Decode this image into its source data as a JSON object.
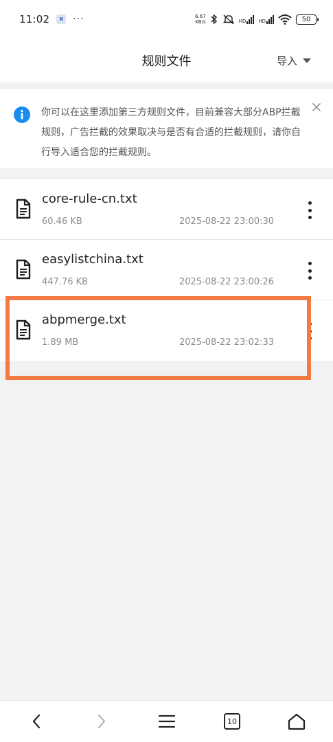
{
  "status_bar": {
    "time": "11:02",
    "app_badge": "x",
    "more_dots": "···",
    "net_speed_value": "6.67",
    "net_speed_unit": "KB/s",
    "signal1_label": "HD",
    "signal2_label": "HD",
    "battery": "50"
  },
  "header": {
    "title": "规则文件",
    "import_label": "导入"
  },
  "notice": {
    "text": "你可以在这里添加第三方规则文件，目前兼容大部分ABP拦截规则，广告拦截的效果取决与是否有合适的拦截规则，请你自行导入适合您的拦截规则。",
    "accent_color": "#1a8cf0"
  },
  "files": [
    {
      "name": "core-rule-cn.txt",
      "size": "60.46 KB",
      "date": "2025-08-22 23:00:30"
    },
    {
      "name": "easylistchina.txt",
      "size": "447.76 KB",
      "date": "2025-08-22 23:00:26"
    },
    {
      "name": "abpmerge.txt",
      "size": "1.89 MB",
      "date": "2025-08-22 23:02:33"
    }
  ],
  "highlight_color": "#f47a44",
  "nav": {
    "tab_count": "10"
  }
}
